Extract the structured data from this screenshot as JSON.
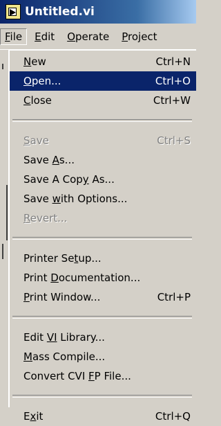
{
  "window": {
    "title": "Untitled.vi"
  },
  "menubar": [
    {
      "key": "F",
      "rest": "ile",
      "open": true
    },
    {
      "key": "E",
      "rest": "dit"
    },
    {
      "key": "O",
      "rest": "perate"
    },
    {
      "key": "P",
      "rest": "roject"
    }
  ],
  "menu": {
    "new": {
      "pre": "",
      "key": "N",
      "post": "ew",
      "shortcut": "Ctrl+N"
    },
    "open": {
      "pre": "",
      "key": "O",
      "post": "pen...",
      "shortcut": "Ctrl+O"
    },
    "close": {
      "pre": "",
      "key": "C",
      "post": "lose",
      "shortcut": "Ctrl+W"
    },
    "save": {
      "pre": "",
      "key": "S",
      "post": "ave",
      "shortcut": "Ctrl+S"
    },
    "save_as": {
      "pre": "Save ",
      "key": "A",
      "post": "s..."
    },
    "save_copy": {
      "pre": "Save A Cop",
      "key": "y",
      "post": " As..."
    },
    "save_options": {
      "pre": "Save ",
      "key": "w",
      "post": "ith Options..."
    },
    "revert": {
      "pre": "",
      "key": "R",
      "post": "evert..."
    },
    "printer_setup": {
      "pre": "Printer Se",
      "key": "t",
      "post": "up..."
    },
    "print_doc": {
      "pre": "Print ",
      "key": "D",
      "post": "ocumentation..."
    },
    "print_window": {
      "pre": "",
      "key": "P",
      "post": "rint Window...",
      "shortcut": "Ctrl+P"
    },
    "edit_vi_lib": {
      "pre": "Edit ",
      "key": "VI",
      "post": " Library..."
    },
    "mass_compile": {
      "pre": "",
      "key": "M",
      "post": "ass Compile..."
    },
    "convert_cvi": {
      "pre": "Convert CVI ",
      "key": "F",
      "post": "P File..."
    },
    "exit": {
      "pre": "E",
      "key": "x",
      "post": "it",
      "shortcut": "Ctrl+Q"
    }
  }
}
